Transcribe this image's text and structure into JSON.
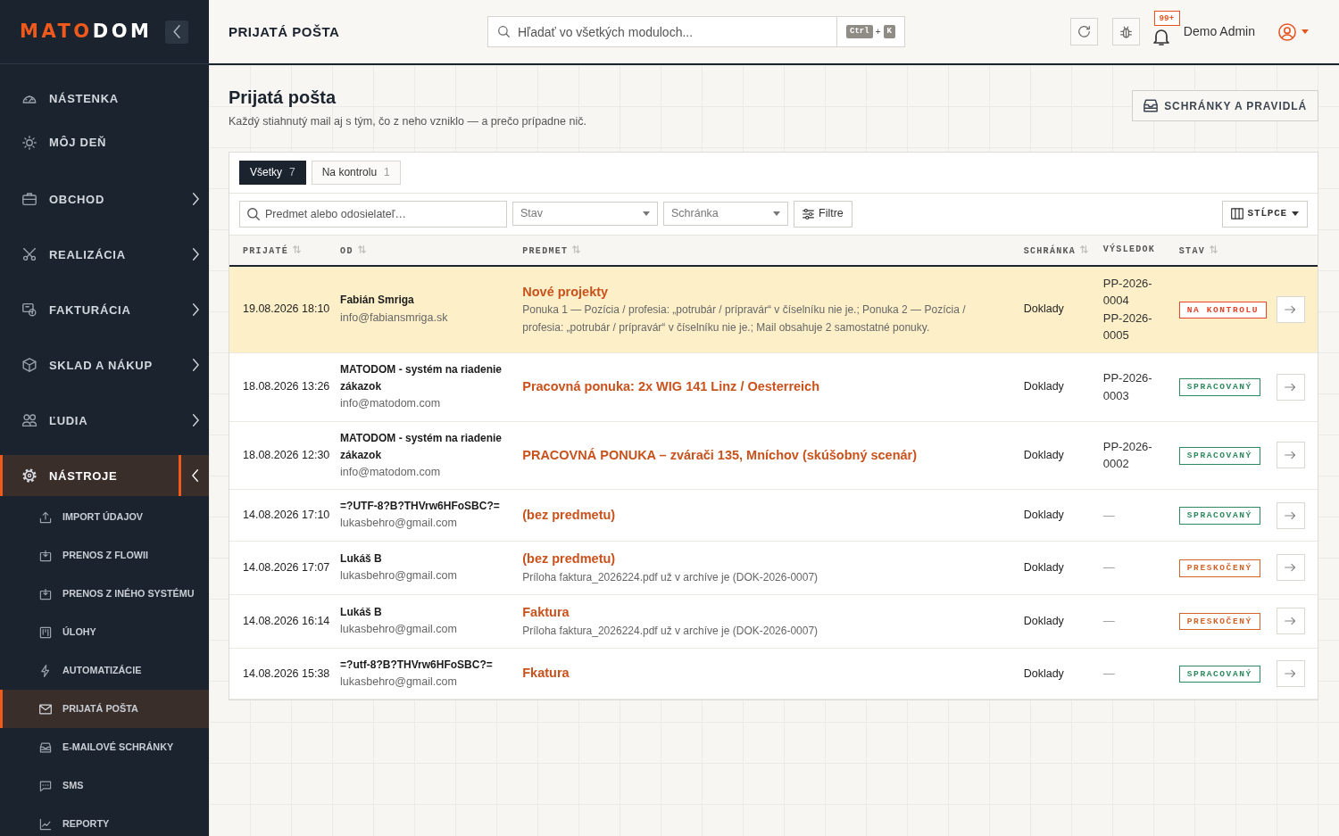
{
  "sidebar": {
    "brand": {
      "lead": "MATO",
      "tail": "DOM"
    },
    "items": [
      {
        "kind": "link",
        "label": "NÁSTENKA",
        "selected": false
      },
      {
        "kind": "link",
        "label": "MÔJ DEŇ",
        "selected": false
      },
      {
        "kind": "group",
        "label": "OBCHOD",
        "selected": false,
        "expanded": false
      },
      {
        "kind": "group",
        "label": "REALIZÁCIA",
        "selected": false,
        "expanded": false
      },
      {
        "kind": "group",
        "label": "FAKTURÁCIA",
        "selected": false,
        "expanded": false
      },
      {
        "kind": "group",
        "label": "SKLAD A NÁKUP",
        "selected": false,
        "expanded": false
      },
      {
        "kind": "group",
        "label": "ĽUDIA",
        "selected": false,
        "expanded": false
      },
      {
        "kind": "group",
        "label": "NÁSTROJE",
        "selected": true,
        "expanded": true,
        "children": [
          {
            "label": "IMPORT ÚDAJOV",
            "selected": false
          },
          {
            "label": "PRENOS Z FLOWII",
            "selected": false
          },
          {
            "label": "PRENOS Z INÉHO SYSTÉMU",
            "selected": false
          },
          {
            "label": "ÚLOHY",
            "selected": false
          },
          {
            "label": "AUTOMATIZÁCIE",
            "selected": false
          },
          {
            "label": "PRIJATÁ POŠTA",
            "selected": true
          },
          {
            "label": "E-MAILOVÉ SCHRÁNKY",
            "selected": false
          },
          {
            "label": "SMS",
            "selected": false
          },
          {
            "label": "REPORTY",
            "selected": false
          }
        ]
      }
    ]
  },
  "topbar": {
    "title": "PRIJATÁ POŠTA",
    "search": {
      "placeholder": "Hľadať vo všetkých moduloch...",
      "shortcut": [
        "Ctrl",
        "+",
        "K"
      ]
    },
    "notifications": "99+",
    "user": "Demo Admin"
  },
  "page": {
    "title": "Prijatá pošta",
    "subtitle": "Každý stiahnutý mail aj s tým, čo z neho vzniklo — a prečo prípadne nič.",
    "rules_button": "SCHRÁNKY A PRAVIDLÁ"
  },
  "mail": {
    "tabs": [
      {
        "label": "Všetky",
        "count": "7",
        "selected": true
      },
      {
        "label": "Na kontrolu",
        "count": "1",
        "selected": false
      }
    ],
    "filters": {
      "search_placeholder": "Predmet alebo odosielateľ…",
      "selects": [
        {
          "placeholder": "Stav"
        },
        {
          "placeholder": "Schránka"
        }
      ],
      "filter_button": "Filtre",
      "columns_button": "STĹPCE"
    },
    "columns": [
      {
        "label": "PRIJATÉ",
        "sortable": true
      },
      {
        "label": "OD",
        "sortable": true
      },
      {
        "label": "PREDMET",
        "sortable": true
      },
      {
        "label": "SCHRÁNKA",
        "sortable": true
      },
      {
        "label": "VÝSLEDOK",
        "sortable": false
      },
      {
        "label": "STAV",
        "sortable": true
      }
    ],
    "rows": [
      {
        "highlighted": true,
        "received": "19.08.2026 18:10",
        "sender": "Fabián Smriga",
        "email": "info@fabiansmriga.sk",
        "subject": "Nové projekty",
        "note": "Ponuka 1 — Pozícia / profesia: „potrubár / prípravár“ v číselníku nie je.; Ponuka 2 — Pozícia / profesia: „potrubár / prípravár“ v číselníku nie je.; Mail obsahuje 2 samostatné ponuky.",
        "mailbox": "Doklady",
        "result": {
          "kind": "codes",
          "items": [
            "PP-2026-0004",
            "PP-2026-0005"
          ]
        },
        "status": {
          "label": "NA KONTROLU",
          "color": "#e5432b"
        }
      },
      {
        "highlighted": false,
        "received": "18.08.2026 13:26",
        "sender": "MATODOM - systém na riadenie zákazok",
        "email": "info@matodom.com",
        "subject": "Pracovná ponuka: 2x WIG 141 Linz / Oesterreich",
        "mailbox": "Doklady",
        "result": {
          "kind": "codes",
          "items": [
            "PP-2026-0003"
          ]
        },
        "status": {
          "label": "SPRACOVANÝ",
          "color": "#2e8a5e"
        }
      },
      {
        "highlighted": false,
        "received": "18.08.2026 12:30",
        "sender": "MATODOM - systém na riadenie zákazok",
        "email": "info@matodom.com",
        "subject": "PRACOVNÁ PONUKA – zvárači 135, Mníchov (skúšobný scenár)",
        "mailbox": "Doklady",
        "result": {
          "kind": "codes",
          "items": [
            "PP-2026-0002"
          ]
        },
        "status": {
          "label": "SPRACOVANÝ",
          "color": "#2e8a5e"
        }
      },
      {
        "highlighted": false,
        "received": "14.08.2026 17:10",
        "sender": "=?UTF-8?B?THVrw6HFoSBC?=",
        "email": "lukasbehro@gmail.com",
        "subject": "(bez predmetu)",
        "mailbox": "Doklady",
        "result": {
          "kind": "none",
          "text": "—"
        },
        "status": {
          "label": "SPRACOVANÝ",
          "color": "#2e8a5e"
        }
      },
      {
        "highlighted": false,
        "received": "14.08.2026 17:07",
        "sender": "Lukáš B",
        "email": "lukasbehro@gmail.com",
        "subject": "(bez predmetu)",
        "note": "Príloha faktura_2026224.pdf už v archíve je (DOK-2026-0007)",
        "mailbox": "Doklady",
        "result": {
          "kind": "none",
          "text": "—"
        },
        "status": {
          "label": "PRESKOČENÝ",
          "color": "#d2642a"
        }
      },
      {
        "highlighted": false,
        "received": "14.08.2026 16:14",
        "sender": "Lukáš B",
        "email": "lukasbehro@gmail.com",
        "subject": "Faktura",
        "note": "Príloha faktura_2026224.pdf už v archíve je (DOK-2026-0007)",
        "mailbox": "Doklady",
        "result": {
          "kind": "none",
          "text": "—"
        },
        "status": {
          "label": "PRESKOČENÝ",
          "color": "#d2642a"
        }
      },
      {
        "highlighted": false,
        "received": "14.08.2026 15:38",
        "sender": "=?utf-8?B?THVrw6HFoSBC?=",
        "email": "lukasbehro@gmail.com",
        "subject": "Fkatura",
        "mailbox": "Doklady",
        "result": {
          "kind": "none",
          "text": "—"
        },
        "status": {
          "label": "SPRACOVANÝ",
          "color": "#2e8a5e"
        }
      }
    ]
  }
}
